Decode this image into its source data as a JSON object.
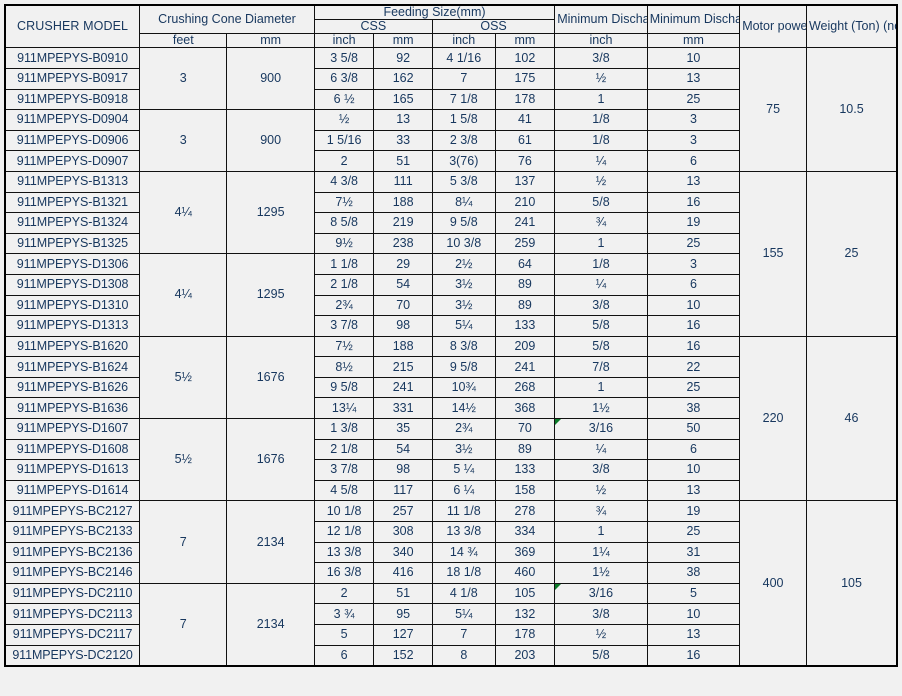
{
  "table": {
    "headers": {
      "crusher_model": "CRUSHER MODEL",
      "cone_diameter": "Crushing Cone Diameter",
      "cone_feet": "feet",
      "cone_mm": "mm",
      "feeding_size": "Feeding Size(mm)",
      "css": "CSS",
      "oss": "OSS",
      "css_inch": "inch",
      "css_mm": "mm",
      "oss_inch": "inch",
      "oss_mm": "mm",
      "min_discharge_inch": "Minimum Discharge Size",
      "min_discharge_mm": "Minimum Discharge Size",
      "discharge_inch_unit": "inch",
      "discharge_mm_unit": "mm",
      "motor_power": "Motor power (KW)",
      "weight": "Weight (Ton) (no Motor)"
    },
    "colors": {
      "text": "#17375e",
      "grid": "#111111",
      "background": "#f1f1f1",
      "comment_marker": "#0b7a28"
    },
    "groups": [
      {
        "cone_feet": "3",
        "cone_mm": "900",
        "motor_power": "75",
        "weight": "10.5",
        "motor_rowspan": 6,
        "rows": [
          {
            "model": "911MPEPYS-B0910",
            "css_inch": "3 5/8",
            "css_mm": "92",
            "oss_inch": "4  1/16",
            "oss_mm": "102",
            "dis_inch": "3/8",
            "dis_mm": "10",
            "marker": false
          },
          {
            "model": "911MPEPYS-B0917",
            "css_inch": "6 3/8",
            "css_mm": "162",
            "oss_inch": "7",
            "oss_mm": "175",
            "dis_inch": "½",
            "dis_mm": "13",
            "marker": false
          },
          {
            "model": "911MPEPYS-B0918",
            "css_inch": "6 ½",
            "css_mm": "165",
            "oss_inch": "7 1/8",
            "oss_mm": "178",
            "dis_inch": "1",
            "dis_mm": "25",
            "marker": false
          }
        ]
      },
      {
        "cone_feet": "3",
        "cone_mm": "900",
        "rows": [
          {
            "model": "911MPEPYS-D0904",
            "css_inch": "½",
            "css_mm": "13",
            "oss_inch": "1 5/8",
            "oss_mm": "41",
            "dis_inch": "1/8",
            "dis_mm": "3",
            "marker": false
          },
          {
            "model": "911MPEPYS-D0906",
            "css_inch": "1  5/16",
            "css_mm": "33",
            "oss_inch": "2 3/8",
            "oss_mm": "61",
            "dis_inch": "1/8",
            "dis_mm": "3",
            "marker": false
          },
          {
            "model": "911MPEPYS-D0907",
            "css_inch": "2",
            "css_mm": "51",
            "oss_inch": "3(76)",
            "oss_mm": "76",
            "dis_inch": "¼",
            "dis_mm": "6",
            "marker": false
          }
        ]
      },
      {
        "cone_feet": "4¼",
        "cone_mm": "1295",
        "motor_power": "155",
        "weight": "25",
        "motor_rowspan": 8,
        "rows": [
          {
            "model": "911MPEPYS-B1313",
            "css_inch": "4 3/8",
            "css_mm": "111",
            "oss_inch": "5 3/8",
            "oss_mm": "137",
            "dis_inch": "½",
            "dis_mm": "13",
            "marker": false
          },
          {
            "model": "911MPEPYS-B1321",
            "css_inch": "7½",
            "css_mm": "188",
            "oss_inch": "8¼",
            "oss_mm": "210",
            "dis_inch": "5/8",
            "dis_mm": "16",
            "marker": false
          },
          {
            "model": "911MPEPYS-B1324",
            "css_inch": "8 5/8",
            "css_mm": "219",
            "oss_inch": "9 5/8",
            "oss_mm": "241",
            "dis_inch": "¾",
            "dis_mm": "19",
            "marker": false
          },
          {
            "model": "911MPEPYS-B1325",
            "css_inch": "9½",
            "css_mm": "238",
            "oss_inch": "10 3/8",
            "oss_mm": "259",
            "dis_inch": "1",
            "dis_mm": "25",
            "marker": false
          }
        ]
      },
      {
        "cone_feet": "4¼",
        "cone_mm": "1295",
        "rows": [
          {
            "model": "911MPEPYS-D1306",
            "css_inch": "1 1/8",
            "css_mm": "29",
            "oss_inch": "2½",
            "oss_mm": "64",
            "dis_inch": "1/8",
            "dis_mm": "3",
            "marker": false
          },
          {
            "model": "911MPEPYS-D1308",
            "css_inch": "2 1/8",
            "css_mm": "54",
            "oss_inch": "3½",
            "oss_mm": "89",
            "dis_inch": "¼",
            "dis_mm": "6",
            "marker": false
          },
          {
            "model": "911MPEPYS-D1310",
            "css_inch": "2¾",
            "css_mm": "70",
            "oss_inch": "3½",
            "oss_mm": "89",
            "dis_inch": "3/8",
            "dis_mm": "10",
            "marker": false
          },
          {
            "model": "911MPEPYS-D1313",
            "css_inch": "3 7/8",
            "css_mm": "98",
            "oss_inch": "5¼",
            "oss_mm": "133",
            "dis_inch": "5/8",
            "dis_mm": "16",
            "marker": false
          }
        ]
      },
      {
        "cone_feet": "5½",
        "cone_mm": "1676",
        "motor_power": "220",
        "weight": "46",
        "motor_rowspan": 8,
        "rows": [
          {
            "model": "911MPEPYS-B1620",
            "css_inch": "7½",
            "css_mm": "188",
            "oss_inch": "8 3/8",
            "oss_mm": "209",
            "dis_inch": "5/8",
            "dis_mm": "16",
            "marker": false
          },
          {
            "model": "911MPEPYS-B1624",
            "css_inch": "8½",
            "css_mm": "215",
            "oss_inch": "9 5/8",
            "oss_mm": "241",
            "dis_inch": "7/8",
            "dis_mm": "22",
            "marker": false
          },
          {
            "model": "911MPEPYS-B1626",
            "css_inch": "9 5/8",
            "css_mm": "241",
            "oss_inch": "10¾",
            "oss_mm": "268",
            "dis_inch": "1",
            "dis_mm": "25",
            "marker": false
          },
          {
            "model": "911MPEPYS-B1636",
            "css_inch": "13¼",
            "css_mm": "331",
            "oss_inch": "14½",
            "oss_mm": "368",
            "dis_inch": "1½",
            "dis_mm": "38",
            "marker": false
          }
        ]
      },
      {
        "cone_feet": "5½",
        "cone_mm": "1676",
        "rows": [
          {
            "model": "911MPEPYS-D1607",
            "css_inch": "1 3/8",
            "css_mm": "35",
            "oss_inch": "2¾",
            "oss_mm": "70",
            "dis_inch": "3/16",
            "dis_mm": "50",
            "marker": true
          },
          {
            "model": "911MPEPYS-D1608",
            "css_inch": "2 1/8",
            "css_mm": "54",
            "oss_inch": "3½",
            "oss_mm": "89",
            "dis_inch": "¼",
            "dis_mm": "6",
            "marker": false
          },
          {
            "model": "911MPEPYS-D1613",
            "css_inch": "3 7/8",
            "css_mm": "98",
            "oss_inch": "5 ¼",
            "oss_mm": "133",
            "dis_inch": "3/8",
            "dis_mm": "10",
            "marker": false
          },
          {
            "model": "911MPEPYS-D1614",
            "css_inch": "4 5/8",
            "css_mm": "117",
            "oss_inch": "6 ¼",
            "oss_mm": "158",
            "dis_inch": "½",
            "dis_mm": "13",
            "marker": false
          }
        ]
      },
      {
        "cone_feet": "7",
        "cone_mm": "2134",
        "motor_power": "400",
        "weight": "105",
        "motor_rowspan": 8,
        "rows": [
          {
            "model": "911MPEPYS-BC2127",
            "css_inch": "10 1/8",
            "css_mm": "257",
            "oss_inch": "11 1/8",
            "oss_mm": "278",
            "dis_inch": "¾",
            "dis_mm": "19",
            "marker": false
          },
          {
            "model": "911MPEPYS-BC2133",
            "css_inch": "12 1/8",
            "css_mm": "308",
            "oss_inch": "13 3/8",
            "oss_mm": "334",
            "dis_inch": "1",
            "dis_mm": "25",
            "marker": false
          },
          {
            "model": "911MPEPYS-BC2136",
            "css_inch": "13 3/8",
            "css_mm": "340",
            "oss_inch": "14 ¾",
            "oss_mm": "369",
            "dis_inch": "1¼",
            "dis_mm": "31",
            "marker": false
          },
          {
            "model": "911MPEPYS-BC2146",
            "css_inch": "16 3/8",
            "css_mm": "416",
            "oss_inch": "18 1/8",
            "oss_mm": "460",
            "dis_inch": "1½",
            "dis_mm": "38",
            "marker": false
          }
        ]
      },
      {
        "cone_feet": "7",
        "cone_mm": "2134",
        "rows": [
          {
            "model": "911MPEPYS-DC2110",
            "css_inch": "2",
            "css_mm": "51",
            "oss_inch": "4 1/8",
            "oss_mm": "105",
            "dis_inch": "3/16",
            "dis_mm": "5",
            "marker": true
          },
          {
            "model": "911MPEPYS-DC2113",
            "css_inch": "3 ¾",
            "css_mm": "95",
            "oss_inch": "5¼",
            "oss_mm": "132",
            "dis_inch": "3/8",
            "dis_mm": "10",
            "marker": false
          },
          {
            "model": "911MPEPYS-DC2117",
            "css_inch": "5",
            "css_mm": "127",
            "oss_inch": "7",
            "oss_mm": "178",
            "dis_inch": "½",
            "dis_mm": "13",
            "marker": false
          },
          {
            "model": "911MPEPYS-DC2120",
            "css_inch": "6",
            "css_mm": "152",
            "oss_inch": "8",
            "oss_mm": "203",
            "dis_inch": "5/8",
            "dis_mm": "16",
            "marker": false
          }
        ]
      }
    ]
  }
}
